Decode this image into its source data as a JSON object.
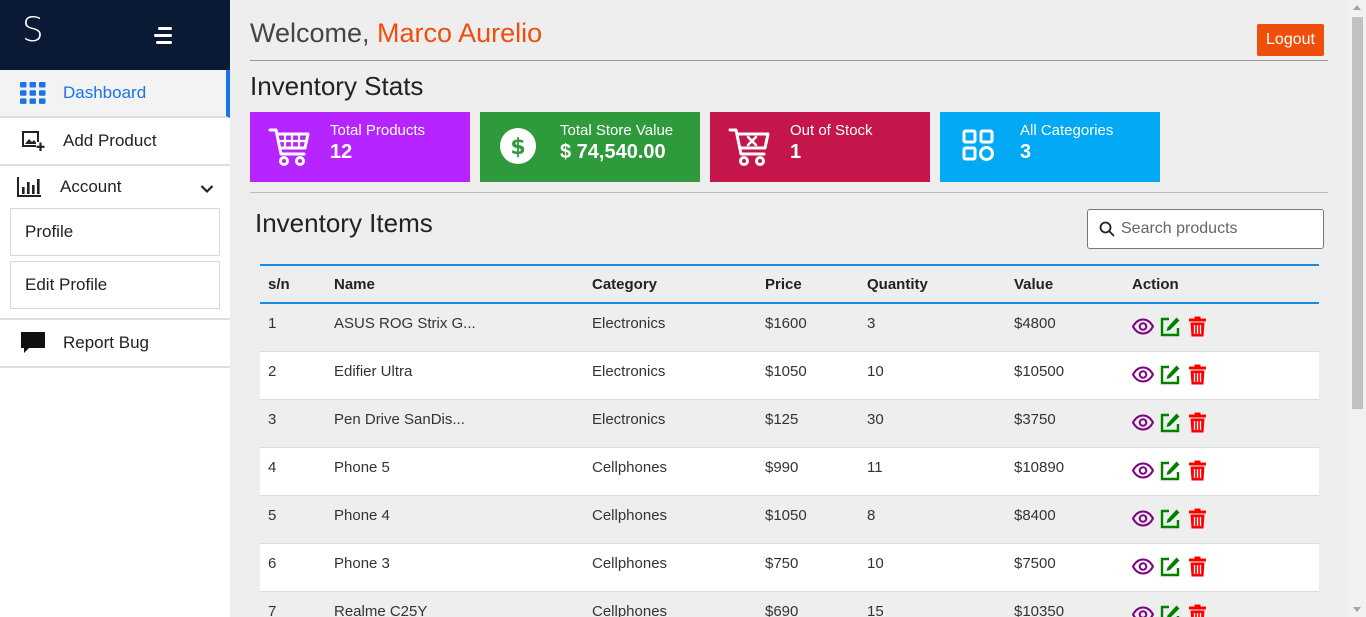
{
  "brand": {
    "logo": "S"
  },
  "sidebar": {
    "items": [
      {
        "label": "Dashboard"
      },
      {
        "label": "Add Product"
      },
      {
        "label": "Account"
      },
      {
        "label": "Profile"
      },
      {
        "label": "Edit Profile"
      },
      {
        "label": "Report Bug"
      }
    ]
  },
  "header": {
    "welcome": "Welcome, ",
    "user_name": "Marco Aurelio",
    "logout_label": "Logout"
  },
  "stats": {
    "title": "Inventory Stats",
    "cards": [
      {
        "label": "Total Products",
        "value": "12",
        "color": "#b624ff",
        "icon": "cart-icon"
      },
      {
        "label": "Total Store Value",
        "value": "$ 74,540.00",
        "color": "#2f9a3b",
        "icon": "dollar-icon"
      },
      {
        "label": "Out of Stock",
        "value": "1",
        "color": "#c4164a",
        "icon": "cart-x-icon"
      },
      {
        "label": "All Categories",
        "value": "3",
        "color": "#03a9f4",
        "icon": "categories-icon"
      }
    ]
  },
  "inventory": {
    "title": "Inventory Items",
    "search_placeholder": "Search products",
    "columns": [
      "s/n",
      "Name",
      "Category",
      "Price",
      "Quantity",
      "Value",
      "Action"
    ],
    "rows": [
      [
        "1",
        "ASUS ROG Strix G...",
        "Electronics",
        "$1600",
        "3",
        "$4800"
      ],
      [
        "2",
        "Edifier Ultra",
        "Electronics",
        "$1050",
        "10",
        "$10500"
      ],
      [
        "3",
        "Pen Drive SanDis...",
        "Electronics",
        "$125",
        "30",
        "$3750"
      ],
      [
        "4",
        "Phone 5",
        "Cellphones",
        "$990",
        "11",
        "$10890"
      ],
      [
        "5",
        "Phone 4",
        "Cellphones",
        "$1050",
        "8",
        "$8400"
      ],
      [
        "6",
        "Phone 3",
        "Cellphones",
        "$750",
        "10",
        "$7500"
      ],
      [
        "7",
        "Realme C25Y",
        "Cellphones",
        "$690",
        "15",
        "$10350"
      ]
    ],
    "action_icons": [
      "eye-icon",
      "edit-icon",
      "trash-icon"
    ],
    "action_colors": {
      "view": "#800080",
      "edit": "#008000",
      "delete": "#ff0000"
    }
  }
}
